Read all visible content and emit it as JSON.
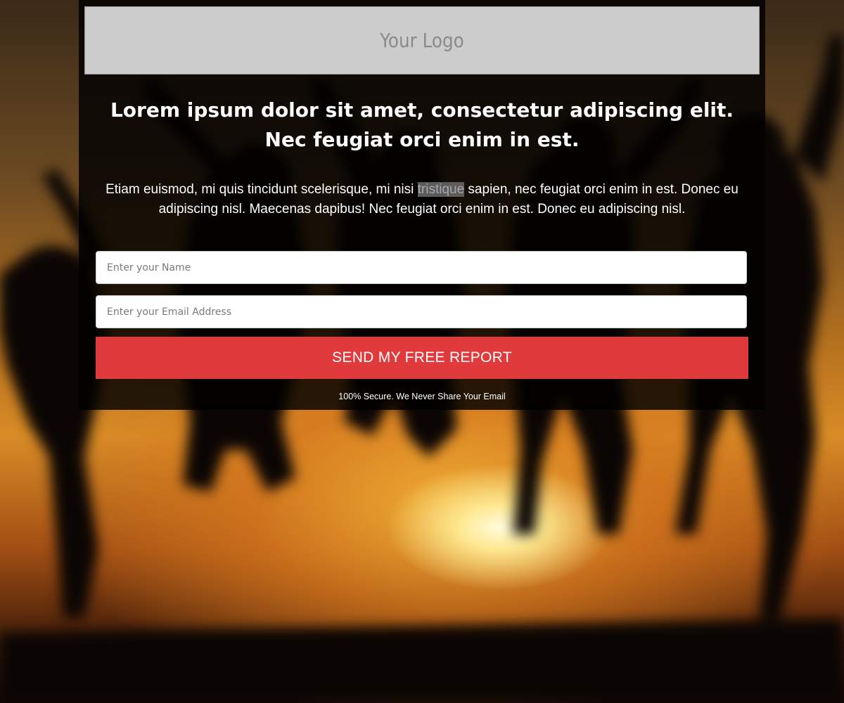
{
  "logo": {
    "text": "Your Logo"
  },
  "hero": {
    "headline": "Lorem ipsum dolor sit amet, consectetur adipiscing elit. Nec feugiat orci enim in est.",
    "body_before": "Etiam euismod, mi quis tincidunt scelerisque, mi nisi ",
    "body_highlight": "tristique",
    "body_after": " sapien, nec feugiat orci enim in est. Donec eu adipiscing nisl. Maecenas dapibus! Nec feugiat orci enim in est. Donec eu adipiscing nisl."
  },
  "form": {
    "name_placeholder": "Enter your Name",
    "email_placeholder": "Enter your Email Address",
    "submit_label": "SEND MY FREE REPORT",
    "secure_note": "100% Secure. We Never Share Your Email"
  },
  "colors": {
    "button": "#e03a3c",
    "logo_bar": "#cccccc",
    "panel": "rgba(0,0,0,0.82)"
  }
}
